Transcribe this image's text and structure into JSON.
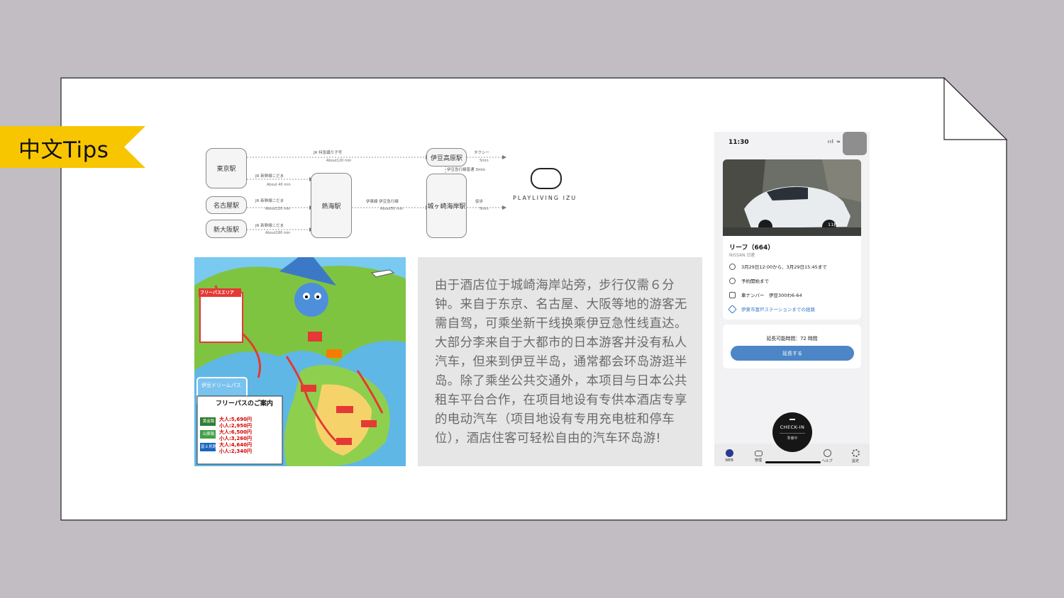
{
  "tag": {
    "label": "中文Tips"
  },
  "diagram": {
    "stations": {
      "tokyo": "東京駅",
      "nagoya": "名古屋駅",
      "shinosaka": "新大阪駅",
      "atami": "熱海駅",
      "izukogen": "伊豆高原駅",
      "jogasaki": "城ヶ崎海岸駅"
    },
    "routes": {
      "tokyo_direct": "JR 特急踊り子号",
      "tokyo_direct_time": "About120 min",
      "tokyo_atami": "JR 新幹線こだま",
      "tokyo_atami_time": "About 40 min",
      "nagoya_atami": "JR 新幹線こだま",
      "nagoya_atami_time": "About120 min",
      "osaka_atami": "JR 新幹線こだま",
      "osaka_atami_time": "About180 min",
      "atami_jogasaki": "伊東線 伊豆急行線",
      "atami_jogasaki_time": "About50 min",
      "taxi": "タクシー",
      "taxi_time": "5min",
      "walk": "徒歩",
      "walk_time": "5min",
      "izukyu": "伊豆急行線普通 3min"
    },
    "brand": "PLAYLIVING IZU"
  },
  "body_text": {
    "paragraph_1": "由于酒店位于城崎海岸站旁，步行仅需６分钟。来自于东京、名古屋、大阪等地的游客无需自驾，可乘坐新干线换乘伊豆急性线直达。",
    "paragraph_2": "大部分李来自于大都市的日本游客并没有私人汽车，但来到伊豆半岛，通常都会环岛游逛半岛。除了乘坐公共交通外，本项目与日本公共租车平台合作，在项目地设有专供本酒店专享的电动汽车（项目地设有专用充电桩和停车位），酒店住客可轻松自由的汽车环岛游!"
  },
  "map": {
    "free_pass_title": "フリーパスのご案内",
    "pass_card": "伊豆ドリームパス",
    "rows": [
      {
        "area": "黄金路",
        "adult": "大人:5,690円",
        "child": "小人:2,950円"
      },
      {
        "area": "山葵路",
        "adult": "大人:6,500円",
        "child": "小人:3,260円"
      },
      {
        "area": "富士見路",
        "adult": "大人:4,640円",
        "child": "小人:2,340円"
      }
    ],
    "banner": "フリーパスエリア"
  },
  "phone": {
    "time": "11:30",
    "status": "ııl ≈ ▭",
    "photo_count": "11枚",
    "car_name": "リーフ（664）",
    "car_maker": "NISSAN 日産",
    "period": "3月29日12:00から、3月29日15:45まで",
    "until_start": "予約開始まで",
    "plate": "車ナンバー　伊豆300わ6-64",
    "route_link": "伊東市富戸ステーションまでの経路",
    "extend_label": "延長可能時間：72 時間",
    "extend_button": "延長する",
    "checkin": "CHECK-IN",
    "checkin_sub": "準備中",
    "tabs": [
      "WEB",
      "管理",
      "",
      "ヘルプ",
      "設定"
    ]
  },
  "colors": {
    "tag": "#f7c600",
    "background": "#c1bdc3",
    "button": "#4c86c6"
  }
}
